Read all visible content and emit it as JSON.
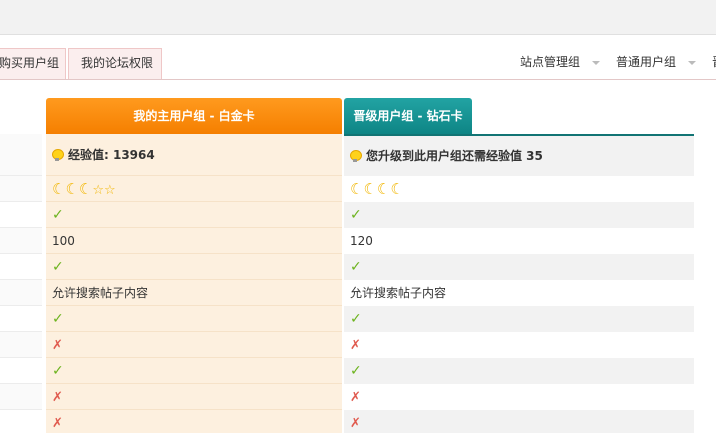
{
  "tabs": {
    "buy": "购买用户组",
    "perm": "我的论坛权限"
  },
  "groups": {
    "site_admin": "站点管理组",
    "normal": "普通用户组",
    "more": "晋"
  },
  "main_group": {
    "header": "我的主用户组 - 白金卡",
    "exp": "经验值: 13964",
    "rows": [
      "✓",
      "100",
      "✓",
      "允许搜索帖子内容",
      "✓",
      "✗",
      "✓",
      "✗",
      "✗"
    ]
  },
  "next_group": {
    "header": "晋级用户组 - 钻石卡",
    "exp": "您升级到此用户组还需经验值 35",
    "rows": [
      "✓",
      "120",
      "✓",
      "允许搜索帖子内容",
      "✓",
      "✗",
      "✓",
      "✗",
      "✗"
    ]
  },
  "icons": {
    "moon": "☾",
    "star": "☆"
  }
}
